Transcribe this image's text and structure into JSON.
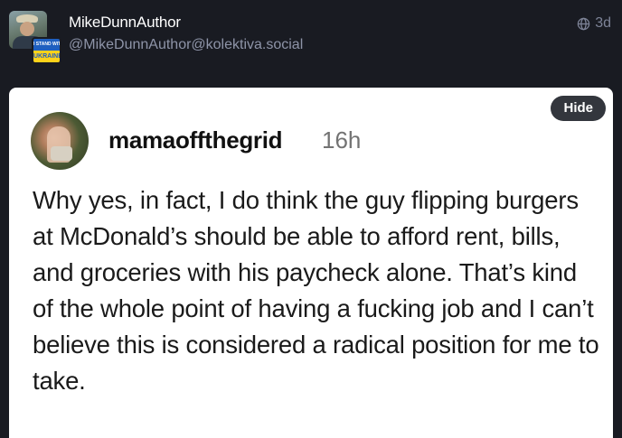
{
  "post": {
    "display_name": "MikeDunnAuthor",
    "handle": "@MikeDunnAuthor@kolektiva.social",
    "time_ago": "3d",
    "visibility_icon": "globe-icon",
    "badge": {
      "top_text": "I STAND WITH",
      "bottom_text": "UKRAINE"
    }
  },
  "media": {
    "hide_label": "Hide",
    "screenshot": {
      "username": "mamaoffthegrid",
      "time": "16h",
      "text": "Why yes, in fact, I do think the guy flipping burgers at McDonald’s should be able to afford rent, bills, and groceries with his paycheck alone. That’s kind of the whole point of having a fucking job and I can’t believe this is considered a radical position for me to take."
    }
  },
  "colors": {
    "background": "#191b22",
    "display_name": "#ffffff",
    "handle": "#8e94a8",
    "hide_button_bg": "#33363d",
    "badge_blue": "#1f5fbf",
    "badge_yellow": "#ffd21a"
  }
}
